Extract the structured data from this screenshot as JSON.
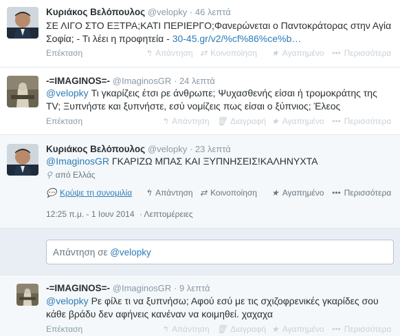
{
  "tweets": [
    {
      "name": "Κυριάκος Βελόπουλος",
      "handle": "@velopky",
      "time": "· 46 λεπτά",
      "text_line1": "ΣΕ ΛΙΓΟ ΣΤΟ ΕΞΤΡΑ;ΚΑΤΙ ΠΕΡΙΕΡΓΟ;Φανερώνεται ο Παντοκράτορας στην Αγία",
      "text_line2_prefix": "Σοφία; - Τι λέει η προφητεία - ",
      "text_line2_link": "30-45.gr/v2/%cf%86%ce%b…",
      "expand": "Επέκταση",
      "reply": "Απάντηση",
      "retweet": "Κοινοποίηση",
      "favorite": "Αγαπημένο",
      "more": "Περισσότερα"
    },
    {
      "name": "-=IMAGINOS=-",
      "handle": "@ImaginosGR",
      "time": "· 24 λεπτά",
      "mention": "@velopky",
      "text_line1": " Τι γκαρίζεις έτσι ρε άνθρωπε; Ψυχασθενής είσαι ή τρομοκράτης της",
      "text_line2": "TV; Ξυπνήστε και ξυπνήστε, εσύ νομίζεις πως είσαι ο ξύπνιος; Έλεος",
      "expand": "Επέκταση",
      "reply": "Απάντηση",
      "delete": "Διαγραφή",
      "favorite": "Αγαπημένο",
      "more": "Περισσότερα"
    },
    {
      "name": "Κυριάκος Βελόπουλος",
      "handle": "@velopky",
      "time": "· 23 λεπτά",
      "mention": "@ImaginosGR",
      "text": " ΓΚΑΡΙΖΩ ΜΠΑΣ ΚΑΙ ΞΥΠΝΗΣΕΙΣ!ΚΑΛΗΝΥΧΤΑ",
      "location": "από Ελλάς",
      "hide_conversation": "Κρύψε τη συνομιλία",
      "reply": "Απάντηση",
      "retweet": "Κοινοποίηση",
      "favorite": "Αγαπημένο",
      "more": "Περισσότερα",
      "timestamp": "12:25 π.μ. - 1 Ιουν 2014",
      "details": "· Λεπτομέρειες"
    },
    {
      "name": "-=IMAGINOS=-",
      "handle": "@ImaginosGR",
      "time": "· 9 λεπτά",
      "mention": "@velopky",
      "text_line1": " Ρε φίλε τι να ξυπνήσω; Αφού εσύ με τις σχιζοφρενικές γκαρίδες σου",
      "text_line2": "κάθε βράδυ δεν αφήνεις κανέναν να κοιμηθεί. χαχαχα",
      "expand": "Επέκταση",
      "reply": "Απάντηση",
      "delete": "Διαγραφή",
      "favorite": "Αγαπημένο",
      "more": "Περισσότερα"
    }
  ],
  "reply_box": {
    "prefix": "Απάντηση σε ",
    "mention": "@velopky"
  },
  "icons": {
    "reply": "reply-icon",
    "retweet": "retweet-icon",
    "favorite": "star-icon",
    "more": "more-dots-icon",
    "delete": "trash-icon",
    "location": "location-pin-icon",
    "conversation": "conversation-bubble-icon"
  },
  "colors": {
    "link": "#2b7bb9",
    "muted": "#8899a6",
    "text": "#292f33",
    "expanded_bg": "#f5f8fa"
  }
}
